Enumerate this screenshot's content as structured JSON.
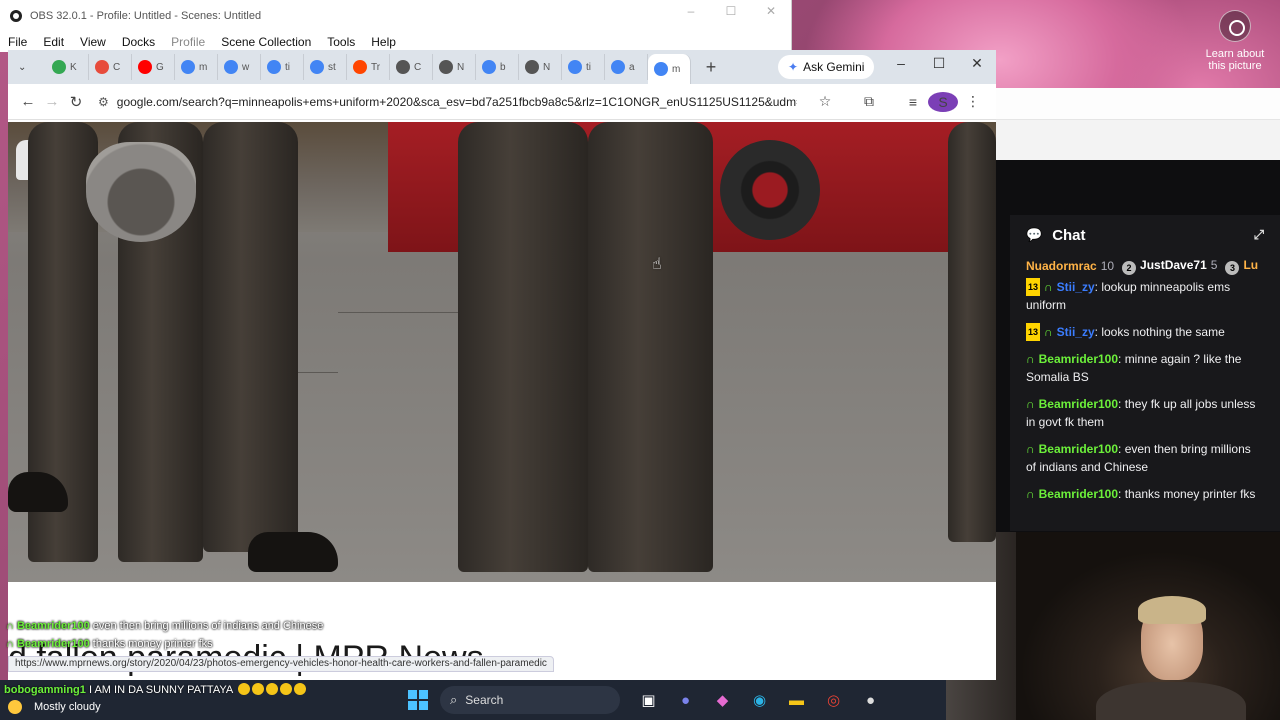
{
  "desktop": {
    "learn_more": "Learn about this picture"
  },
  "obs": {
    "title": "OBS 32.0.1 - Profile: Untitled - Scenes: Untitled",
    "menu": [
      "File",
      "Edit",
      "View",
      "Docks",
      "Profile",
      "Scene Collection",
      "Tools",
      "Help"
    ],
    "win_buttons": [
      "–",
      "☐",
      "✕"
    ]
  },
  "chrome": {
    "tabs": [
      {
        "letter": "K",
        "color": "#34a853"
      },
      {
        "letter": "C",
        "color": "#e74c3c"
      },
      {
        "letter": "G",
        "color": "#ff0000"
      },
      {
        "letter": "m",
        "color": "#4285f4"
      },
      {
        "letter": "w",
        "color": "#4285f4"
      },
      {
        "letter": "ti",
        "color": "#4285f4"
      },
      {
        "letter": "st",
        "color": "#4285f4"
      },
      {
        "letter": "Tr",
        "color": "#ff4500"
      },
      {
        "letter": "C",
        "color": "#555555"
      },
      {
        "letter": "N",
        "color": "#555555"
      },
      {
        "letter": "b",
        "color": "#4285f4"
      },
      {
        "letter": "N",
        "color": "#555555"
      },
      {
        "letter": "ti",
        "color": "#4285f4"
      },
      {
        "letter": "a",
        "color": "#4285f4"
      },
      {
        "letter": "m",
        "color": "#4285f4"
      }
    ],
    "new_tab": "+",
    "gemini_label": "Ask Gemini",
    "url": "google.com/search?q=minneapolis+ems+uniform+2020&sca_esv=bd7a251fbcb9a8c5&rlz=1C1ONGR_enUS1125US1125&udm=...",
    "avatar_letter": "S",
    "result_title": "d fallen paramedic | MPR News",
    "status_url": "https://www.mprnews.org/story/2020/04/23/photos-emergency-vehicles-honor-health-care-workers-and-fallen-paramedic"
  },
  "overlay_chat": [
    {
      "name": "Beamrider100",
      "text": " even then bring millions of indians and Chinese"
    },
    {
      "name": "Beamrider100",
      "text": " thanks money printer fks"
    }
  ],
  "bobo": {
    "name": "bobogamming1",
    "text": " I AM IN DA SUNNY PATTAYA"
  },
  "weather": "Mostly cloudy",
  "taskbar": {
    "search": "Search"
  },
  "chat": {
    "title": "Chat",
    "leaderboard": [
      {
        "rank": "1",
        "name": "Nuadormrac",
        "count": "10"
      },
      {
        "rank": "2",
        "name": "JustDave71",
        "count": "5"
      },
      {
        "rank": "3",
        "name": "Lu",
        "count": ""
      }
    ],
    "messages": [
      {
        "sub": "13",
        "user": "Stii_zy",
        "user_color": "blue",
        "text": "lookup minneapolis ems uniform"
      },
      {
        "sub": "13",
        "user": "Stii_zy",
        "user_color": "blue",
        "text": "looks nothing the same"
      },
      {
        "sub": "",
        "user": "Beamrider100",
        "user_color": "green",
        "text": "minne again ? like the Somalia BS"
      },
      {
        "sub": "",
        "user": "Beamrider100",
        "user_color": "green",
        "text": "they fk up all jobs unless in govt fk them"
      },
      {
        "sub": "",
        "user": "Beamrider100",
        "user_color": "green",
        "text": "even then bring millions of indians and Chinese"
      },
      {
        "sub": "",
        "user": "Beamrider100",
        "user_color": "green",
        "text": "thanks money printer fks"
      }
    ]
  }
}
